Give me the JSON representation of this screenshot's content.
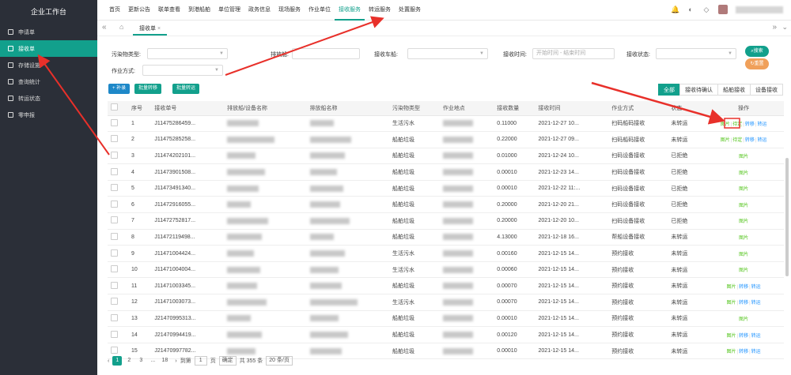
{
  "sidebar": {
    "title": "企业工作台",
    "items": [
      {
        "label": "申请单",
        "active": false
      },
      {
        "label": "接收单",
        "active": true
      },
      {
        "label": "存储设施",
        "active": false
      },
      {
        "label": "查询统计",
        "active": false
      },
      {
        "label": "转运状态",
        "active": false
      },
      {
        "label": "零申报",
        "active": false
      }
    ]
  },
  "topnav": {
    "items": [
      "首页",
      "更新公告",
      "联单查看",
      "到港船舶",
      "单位管理",
      "政务信息",
      "现场服务",
      "作业单位",
      "接收服务",
      "转运服务",
      "处置服务"
    ],
    "active_index": 8
  },
  "tabbar": {
    "tab_label": "接收单",
    "close": "×"
  },
  "filters": {
    "pollutant_type_label": "污染物类型:",
    "discharge_ship_label": "排放船:",
    "receive_ship_label": "接收车船:",
    "receive_time_label": "接收时间:",
    "receive_time_placeholder": "开始时间 - 结束时间",
    "receive_status_label": "接收状态:",
    "operation_mode_label": "作业方式:",
    "search_label": "搜索",
    "reset_label": "重置"
  },
  "actions": {
    "add_label": "+ 补录",
    "batch_transfer_label": "批量转移",
    "batch_transport_label": "批量转运"
  },
  "filter_tabs": [
    "全部",
    "接收待确认",
    "船舶接收",
    "设备接收"
  ],
  "table": {
    "headers": [
      "序号",
      "接收单号",
      "排放船/设备名称",
      "排放船名称",
      "污染物类型",
      "作业地点",
      "接收数量",
      "接收时间",
      "作业方式",
      "状态",
      "操作"
    ],
    "rows": [
      {
        "no": "1",
        "id": "J11475286459...",
        "ptype": "生活污水",
        "qty": "0.11000",
        "time": "2021-12-27 10...",
        "mode": "扫码船码接收",
        "status": "未转运",
        "ops": [
          "图片",
          "待定",
          "转移",
          "转运"
        ]
      },
      {
        "no": "2",
        "id": "J11475285258...",
        "ptype": "船舶垃圾",
        "qty": "0.22000",
        "time": "2021-12-27 09...",
        "mode": "扫码船码接收",
        "status": "未转运",
        "ops": [
          "图片",
          "待定",
          "转移",
          "转运"
        ]
      },
      {
        "no": "3",
        "id": "J11474202101...",
        "ptype": "船舶垃圾",
        "qty": "0.01000",
        "time": "2021-12-24 10...",
        "mode": "扫码设备接收",
        "status": "已拒绝",
        "ops": [
          "图片"
        ]
      },
      {
        "no": "4",
        "id": "J11473901508...",
        "ptype": "船舶垃圾",
        "qty": "0.00010",
        "time": "2021-12-23 14...",
        "mode": "扫码设备接收",
        "status": "已拒绝",
        "ops": [
          "图片"
        ]
      },
      {
        "no": "5",
        "id": "J11473491340...",
        "ptype": "船舶垃圾",
        "qty": "0.00010",
        "time": "2021-12-22 11:...",
        "mode": "扫码设备接收",
        "status": "已拒绝",
        "ops": [
          "图片"
        ]
      },
      {
        "no": "6",
        "id": "J11472916055...",
        "ptype": "船舶垃圾",
        "qty": "0.20000",
        "time": "2021-12-20 21...",
        "mode": "扫码设备接收",
        "status": "已拒绝",
        "ops": [
          "图片"
        ]
      },
      {
        "no": "7",
        "id": "J11472752817...",
        "ptype": "船舶垃圾",
        "qty": "0.20000",
        "time": "2021-12-20 10...",
        "mode": "扫码设备接收",
        "status": "已拒绝",
        "ops": [
          "图片"
        ]
      },
      {
        "no": "8",
        "id": "J11472119498...",
        "ptype": "船舶垃圾",
        "qty": "4.13000",
        "time": "2021-12-18 16...",
        "mode": "帮船设备接收",
        "status": "未转运",
        "ops": [
          "图片"
        ]
      },
      {
        "no": "9",
        "id": "J11471004424...",
        "ptype": "生活污水",
        "qty": "0.00160",
        "time": "2021-12-15 14...",
        "mode": "预约接收",
        "status": "未转运",
        "ops": [
          "图片"
        ]
      },
      {
        "no": "10",
        "id": "J11471004004...",
        "ptype": "生活污水",
        "qty": "0.00060",
        "time": "2021-12-15 14...",
        "mode": "预约接收",
        "status": "未转运",
        "ops": [
          "图片"
        ]
      },
      {
        "no": "11",
        "id": "J11471003345...",
        "ptype": "船舶垃圾",
        "qty": "0.00070",
        "time": "2021-12-15 14...",
        "mode": "预约接收",
        "status": "未转运",
        "ops": [
          "图片",
          "转移",
          "转运"
        ]
      },
      {
        "no": "12",
        "id": "J11471003073...",
        "ptype": "生活污水",
        "qty": "0.00070",
        "time": "2021-12-15 14...",
        "mode": "预约接收",
        "status": "未转运",
        "ops": [
          "图片",
          "转移",
          "转运"
        ]
      },
      {
        "no": "13",
        "id": "J21470995313...",
        "ptype": "船舶垃圾",
        "qty": "0.00010",
        "time": "2021-12-15 14...",
        "mode": "预约接收",
        "status": "未转运",
        "ops": [
          "图片"
        ]
      },
      {
        "no": "14",
        "id": "J21470994419...",
        "ptype": "船舶垃圾",
        "qty": "0.00120",
        "time": "2021-12-15 14...",
        "mode": "预约接收",
        "status": "未转运",
        "ops": [
          "图片",
          "转移",
          "转运"
        ]
      },
      {
        "no": "15",
        "id": "J21470997782...",
        "ptype": "船舶垃圾",
        "qty": "0.00010",
        "time": "2021-12-15 14...",
        "mode": "预约接收",
        "status": "未转运",
        "ops": [
          "图片",
          "转移",
          "转运"
        ]
      }
    ]
  },
  "pager": {
    "pages": [
      "1",
      "2",
      "3",
      "...",
      "18"
    ],
    "goto_label": "到第",
    "goto_value": "1",
    "page_unit": "页",
    "confirm_label": "确定",
    "total_label": "共 355 条",
    "page_size_label": "20 条/页"
  },
  "colors": {
    "accent": "#12a08c",
    "sidebar_bg": "#2b2f38",
    "annotation_red": "#e8302a"
  }
}
